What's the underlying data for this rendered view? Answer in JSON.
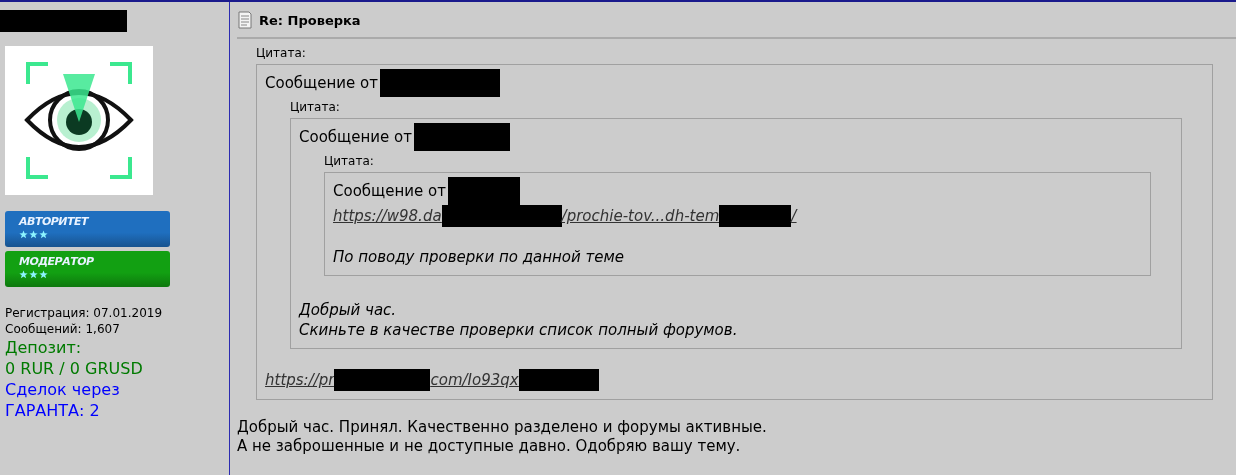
{
  "user": {
    "name_parts": [
      {
        "kind": "redacted"
      }
    ],
    "badges": [
      {
        "label": "АВТОРИТЕТ",
        "stars": 3,
        "color": "#1f6fbf"
      },
      {
        "label": "МОДЕРАТОР",
        "stars": 3,
        "color": "#12a012"
      }
    ],
    "stats": [
      {
        "kind": "plain",
        "text": "Регистрация: 07.01.2019"
      },
      {
        "kind": "plain",
        "text": "Сообщений: 1,607"
      },
      {
        "kind": "deposit",
        "text": "Депозит:"
      },
      {
        "kind": "deposit",
        "text": "0 RUR / 0 GRUSD"
      },
      {
        "kind": "deals",
        "text": "Сделок через"
      },
      {
        "kind": "deals",
        "text": "ГАРАНТА: 2"
      }
    ]
  },
  "post": {
    "title": "Re: Проверка",
    "quote": {
      "label": "Цитата:",
      "author_parts": [
        {
          "kind": "text",
          "text": "Сообщение от"
        },
        {
          "kind": "redacted"
        }
      ],
      "blocks": [
        {
          "kind": "quote",
          "quote": {
            "label": "Цитата:",
            "author_parts": [
              {
                "kind": "text",
                "text": "Сообщение от"
              },
              {
                "kind": "redacted"
              }
            ],
            "blocks": [
              {
                "kind": "quote",
                "quote": {
                  "label": "Цитата:",
                  "author_parts": [
                    {
                      "kind": "text",
                      "text": "Сообщение от"
                    },
                    {
                      "kind": "redacted"
                    }
                  ],
                  "blocks": [
                    {
                      "kind": "link",
                      "parts": [
                        {
                          "kind": "text",
                          "text": "https://w98.da"
                        },
                        {
                          "kind": "redacted"
                        },
                        {
                          "kind": "text",
                          "text": "/prochie-tov...dh-tem"
                        },
                        {
                          "kind": "redacted"
                        },
                        {
                          "kind": "text",
                          "text": "/"
                        }
                      ]
                    },
                    {
                      "kind": "text",
                      "italic": true,
                      "lines": [
                        "По поводу проверки по данной теме"
                      ]
                    }
                  ]
                }
              },
              {
                "kind": "text",
                "italic": true,
                "lines": [
                  "Добрый час.",
                  "Скиньте в качестве проверки список полный форумов."
                ]
              }
            ]
          }
        },
        {
          "kind": "link",
          "parts": [
            {
              "kind": "text",
              "text": "https://pr"
            },
            {
              "kind": "redacted"
            },
            {
              "kind": "text",
              "text": "com/Io93qx"
            },
            {
              "kind": "redacted"
            }
          ]
        }
      ]
    },
    "body": [
      "Добрый час. Принял. Качественно разделено и форумы активные.",
      "А не заброшенные и не доступные давно. Одобряю вашу тему."
    ]
  }
}
